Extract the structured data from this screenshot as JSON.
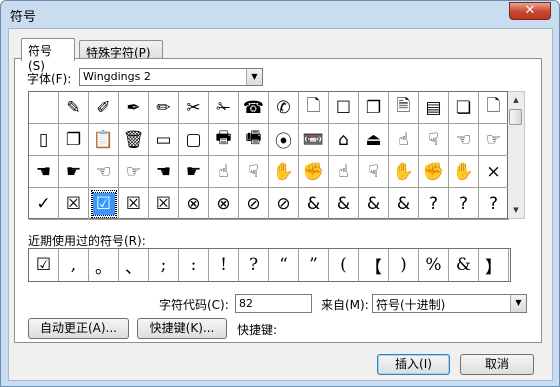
{
  "window": {
    "title": "符号",
    "close_label": "✕"
  },
  "tabs": [
    {
      "label": "符号(S)",
      "active": true
    },
    {
      "label": "特殊字符(P)",
      "active": false
    }
  ],
  "font": {
    "label": "字体(F):",
    "value": "Wingdings 2"
  },
  "symbols": [
    "",
    "✎",
    "✐",
    "✒",
    "✏",
    "✂",
    "✁",
    "☎",
    "✆",
    "🗋",
    "☐",
    "❐",
    "🗎",
    "▤",
    "❏",
    "🗋",
    "▯",
    "❐",
    "📋",
    "🗑",
    "▭",
    "▢",
    "🖶",
    "🖷",
    "⦿",
    "📼",
    "⌂",
    "⏏",
    "☝",
    "☟",
    "☜",
    "☞",
    "☚",
    "☛",
    "☜",
    "☞",
    "☚",
    "☛",
    "☝",
    "☟",
    "✋",
    "✊",
    "☝",
    "☟",
    "✋",
    "✊",
    "✋",
    "×",
    "✓",
    "☒",
    "☑",
    "☒",
    "☒",
    "⊗",
    "⊗",
    "⊘",
    "⊘",
    "&",
    "&",
    "&",
    "&",
    "?",
    "?",
    "?"
  ],
  "selected_index": 50,
  "recent": {
    "label": "近期使用过的符号(R):",
    "symbols": [
      "☑",
      ",",
      "。",
      "、",
      ";",
      ":",
      "!",
      "?",
      "“",
      "”",
      "(",
      "【",
      ")",
      "%",
      "&",
      "】"
    ]
  },
  "char_code": {
    "label": "字符代码(C):",
    "value": "82"
  },
  "from": {
    "label": "来自(M):",
    "value": "符号(十进制)"
  },
  "buttons": {
    "autocorrect": "自动更正(A)...",
    "shortcut_key": "快捷键(K)...",
    "shortcut_label": "快捷键:",
    "insert": "插入(I)",
    "cancel": "取消"
  }
}
